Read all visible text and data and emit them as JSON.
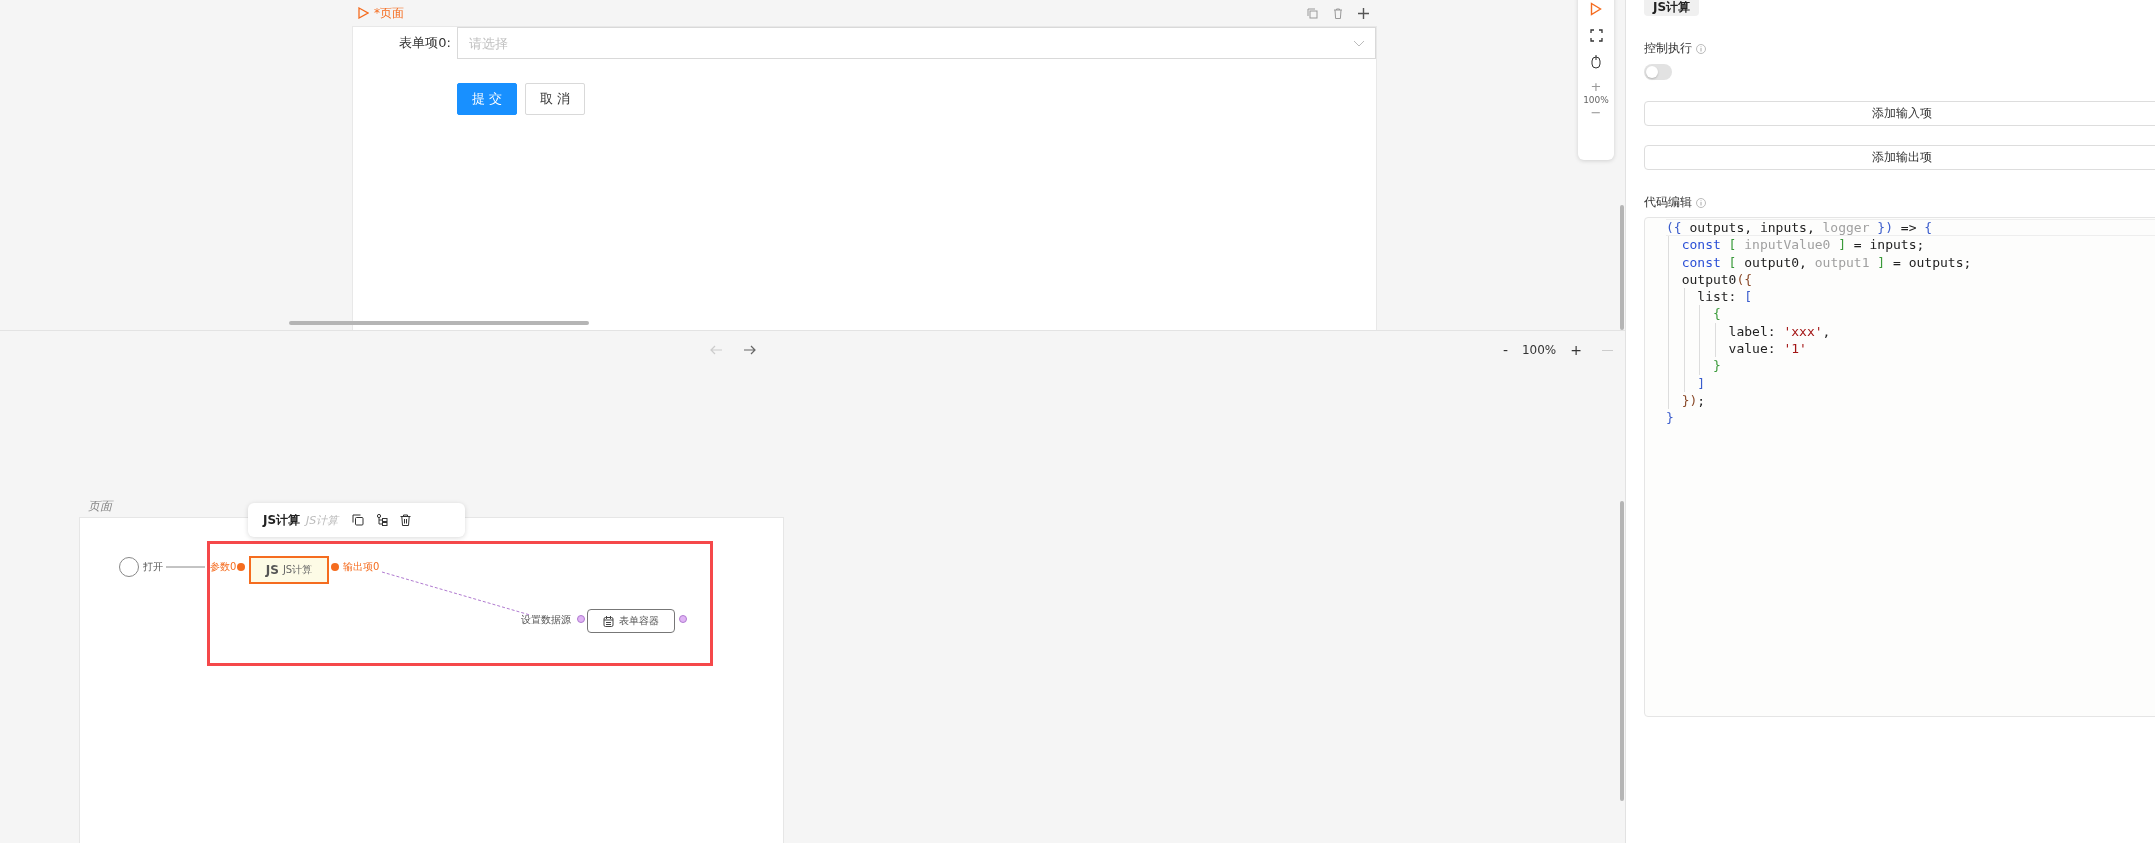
{
  "page_tab": {
    "title": "*页面"
  },
  "form": {
    "field_label": "表单项0:",
    "placeholder": "请选择",
    "buttons": [
      {
        "label": "提 交",
        "kind": "primary"
      },
      {
        "label": "取 消",
        "kind": "default"
      }
    ]
  },
  "side_toolbar": {
    "zoom": "100%",
    "zoom_in": "+",
    "zoom_out": "−"
  },
  "history_bar": {
    "zoom": "100%",
    "zoom_out": "-",
    "zoom_in": "+"
  },
  "canvas": {
    "title": "页面",
    "node_toolbar": {
      "title": "JS计算",
      "subtitle": "JS计算"
    },
    "start": {
      "label": "打开"
    },
    "js_node": {
      "badge": "JS",
      "label": "JS计算",
      "input": "参数0",
      "output": "输出项0",
      "selected": true
    },
    "form_node": {
      "label": "表单容器",
      "input": "设置数据源"
    }
  },
  "panel": {
    "tag": "JS计算",
    "control_label": "控制执行",
    "control_on": false,
    "add_input": "添加输入项",
    "add_output": "添加输出项",
    "code_label": "代码编辑",
    "code_lines": [
      [
        {
          "t": "({",
          "kind": "blue"
        },
        {
          "t": " outputs, inputs, ",
          "kind": "plain"
        },
        {
          "t": "logger",
          "kind": "muted"
        },
        {
          "t": " })",
          "kind": "blue"
        },
        {
          "t": " => ",
          "kind": "plain"
        },
        {
          "t": "{",
          "kind": "blue"
        }
      ],
      [
        {
          "t": "  const",
          "kind": "keyword"
        },
        {
          "t": " [",
          "kind": "green"
        },
        {
          "t": " inputValue0 ",
          "kind": "muted"
        },
        {
          "t": "]",
          "kind": "green"
        },
        {
          "t": " = inputs;",
          "kind": "plain"
        }
      ],
      [
        {
          "t": "  const",
          "kind": "keyword"
        },
        {
          "t": " [",
          "kind": "green"
        },
        {
          "t": " output0, ",
          "kind": "plain"
        },
        {
          "t": "output1 ",
          "kind": "muted"
        },
        {
          "t": "]",
          "kind": "green"
        },
        {
          "t": " = outputs;",
          "kind": "plain"
        }
      ],
      [
        {
          "t": "  output0",
          "kind": "plain"
        },
        {
          "t": "({",
          "kind": "brown"
        }
      ],
      [
        {
          "t": "    list: ",
          "kind": "plain"
        },
        {
          "t": "[",
          "kind": "blue"
        }
      ],
      [
        {
          "t": "      {",
          "kind": "green"
        }
      ],
      [
        {
          "t": "        label: ",
          "kind": "plain"
        },
        {
          "t": "'xxx'",
          "kind": "string"
        },
        {
          "t": ",",
          "kind": "plain"
        }
      ],
      [
        {
          "t": "        value: ",
          "kind": "plain"
        },
        {
          "t": "'1'",
          "kind": "string"
        }
      ],
      [
        {
          "t": "      }",
          "kind": "green"
        }
      ],
      [
        {
          "t": "    ]",
          "kind": "blue"
        }
      ],
      [
        {
          "t": "  })",
          "kind": "brown"
        },
        {
          "t": ";",
          "kind": "plain"
        }
      ],
      [
        {
          "t": "}",
          "kind": "blue"
        }
      ]
    ]
  }
}
